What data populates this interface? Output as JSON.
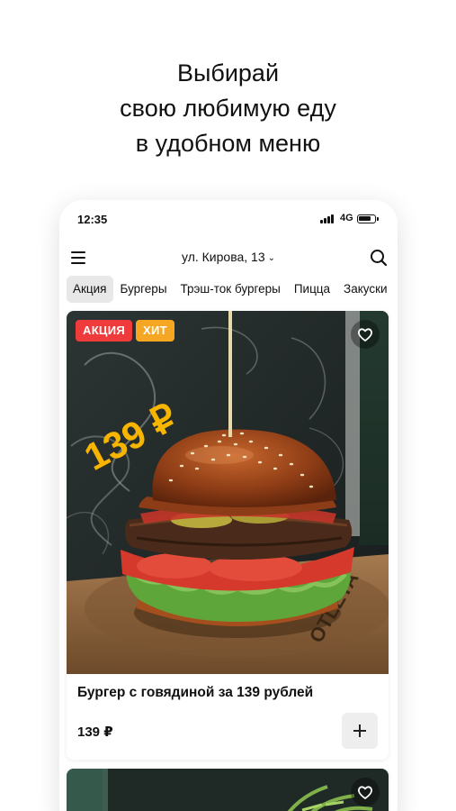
{
  "headline": {
    "line1": "Выбирай",
    "line2": "свою любимую еду",
    "line3": "в удобном меню"
  },
  "statusbar": {
    "time": "12:35",
    "network": "4G"
  },
  "appbar": {
    "address": "ул. Кирова, 13",
    "menu_icon": "hamburger-menu-icon",
    "search_icon": "search-icon"
  },
  "tabs": [
    {
      "label": "Акция",
      "active": true
    },
    {
      "label": "Бургеры"
    },
    {
      "label": "Трэш-ток бургеры"
    },
    {
      "label": "Пицца"
    },
    {
      "label": "Закуски"
    }
  ],
  "products": [
    {
      "badges": [
        {
          "label": "АКЦИЯ",
          "color": "#ef3b3b"
        },
        {
          "label": "ХИТ",
          "color": "#f5a623"
        }
      ],
      "image_price_text": "139 ₽",
      "board_text": "OTLETA",
      "title": "Бургер с говядиной за 139 рублей",
      "price": "139 ₽",
      "favorite_icon": "heart-icon",
      "add_icon": "plus-icon"
    },
    {
      "favorite_icon": "heart-icon"
    }
  ],
  "colors": {
    "promo_badge": "#ef3b3b",
    "hit_badge": "#f5a623",
    "price_overlay": "#f7b500"
  }
}
